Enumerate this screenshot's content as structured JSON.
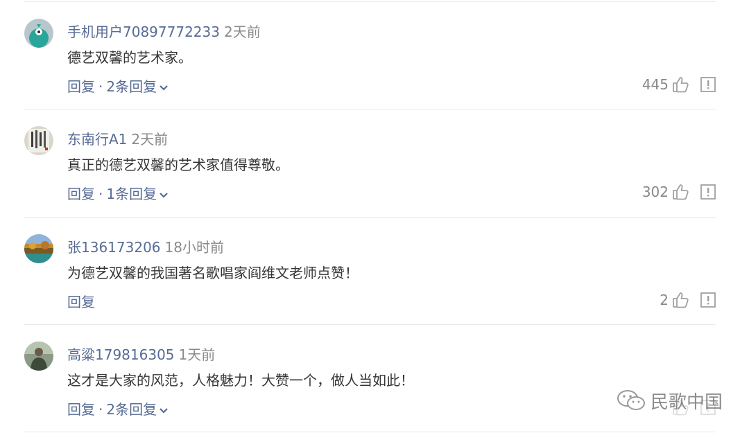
{
  "comments": [
    {
      "username": "手机用户70897772233",
      "time": "2天前",
      "text": "德艺双馨的艺术家。",
      "reply_label": "回复",
      "sep": "·",
      "replies_label": "2条回复",
      "likes": "445",
      "avatar_icon": "teal-bird-avatar"
    },
    {
      "username": "东南行A1",
      "time": "2天前",
      "text": "真正的德艺双馨的艺术家值得尊敬。",
      "reply_label": "回复",
      "sep": "·",
      "replies_label": "1条回复",
      "likes": "302",
      "avatar_icon": "calligraphy-avatar"
    },
    {
      "username": "张136173206",
      "time": "18小时前",
      "text": "为德艺双馨的我国著名歌唱家阎维文老师点赞！",
      "reply_label": "回复",
      "likes": "2",
      "avatar_icon": "landscape-avatar"
    },
    {
      "username": "高粱179816305",
      "time": "1天前",
      "text": "这才是大家的风范，人格魅力！大赞一个，做人当如此！",
      "reply_label": "回复",
      "sep": "·",
      "replies_label": "2条回复",
      "likes": "",
      "avatar_icon": "person-photo-avatar"
    }
  ],
  "watermark": {
    "text": "民歌中国",
    "icon": "wechat-icon"
  },
  "colors": {
    "link": "#576b95",
    "text": "#353535",
    "muted": "#888888"
  }
}
